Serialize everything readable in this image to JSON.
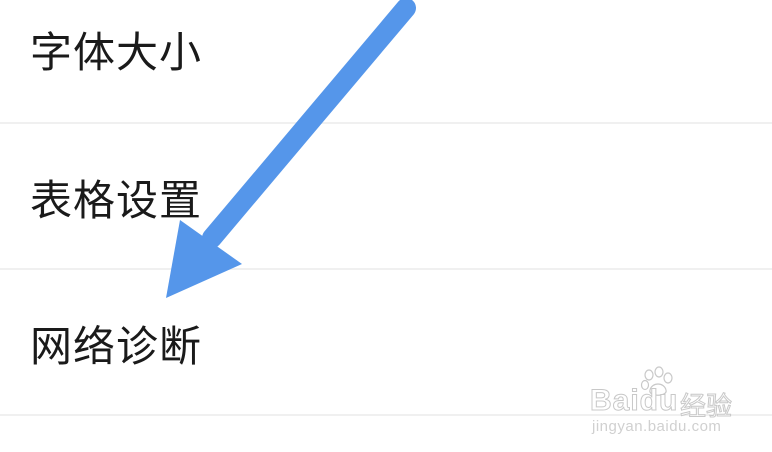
{
  "settings": {
    "items": [
      {
        "label": "字体大小"
      },
      {
        "label": "表格设置"
      },
      {
        "label": "网络诊断"
      }
    ]
  },
  "annotation": {
    "arrow_color": "#5596ea",
    "arrow_icon": "arrow-down-left-icon"
  },
  "watermark": {
    "logo": "Baidu",
    "brand": "经验",
    "url": "jingyan.baidu.com"
  }
}
